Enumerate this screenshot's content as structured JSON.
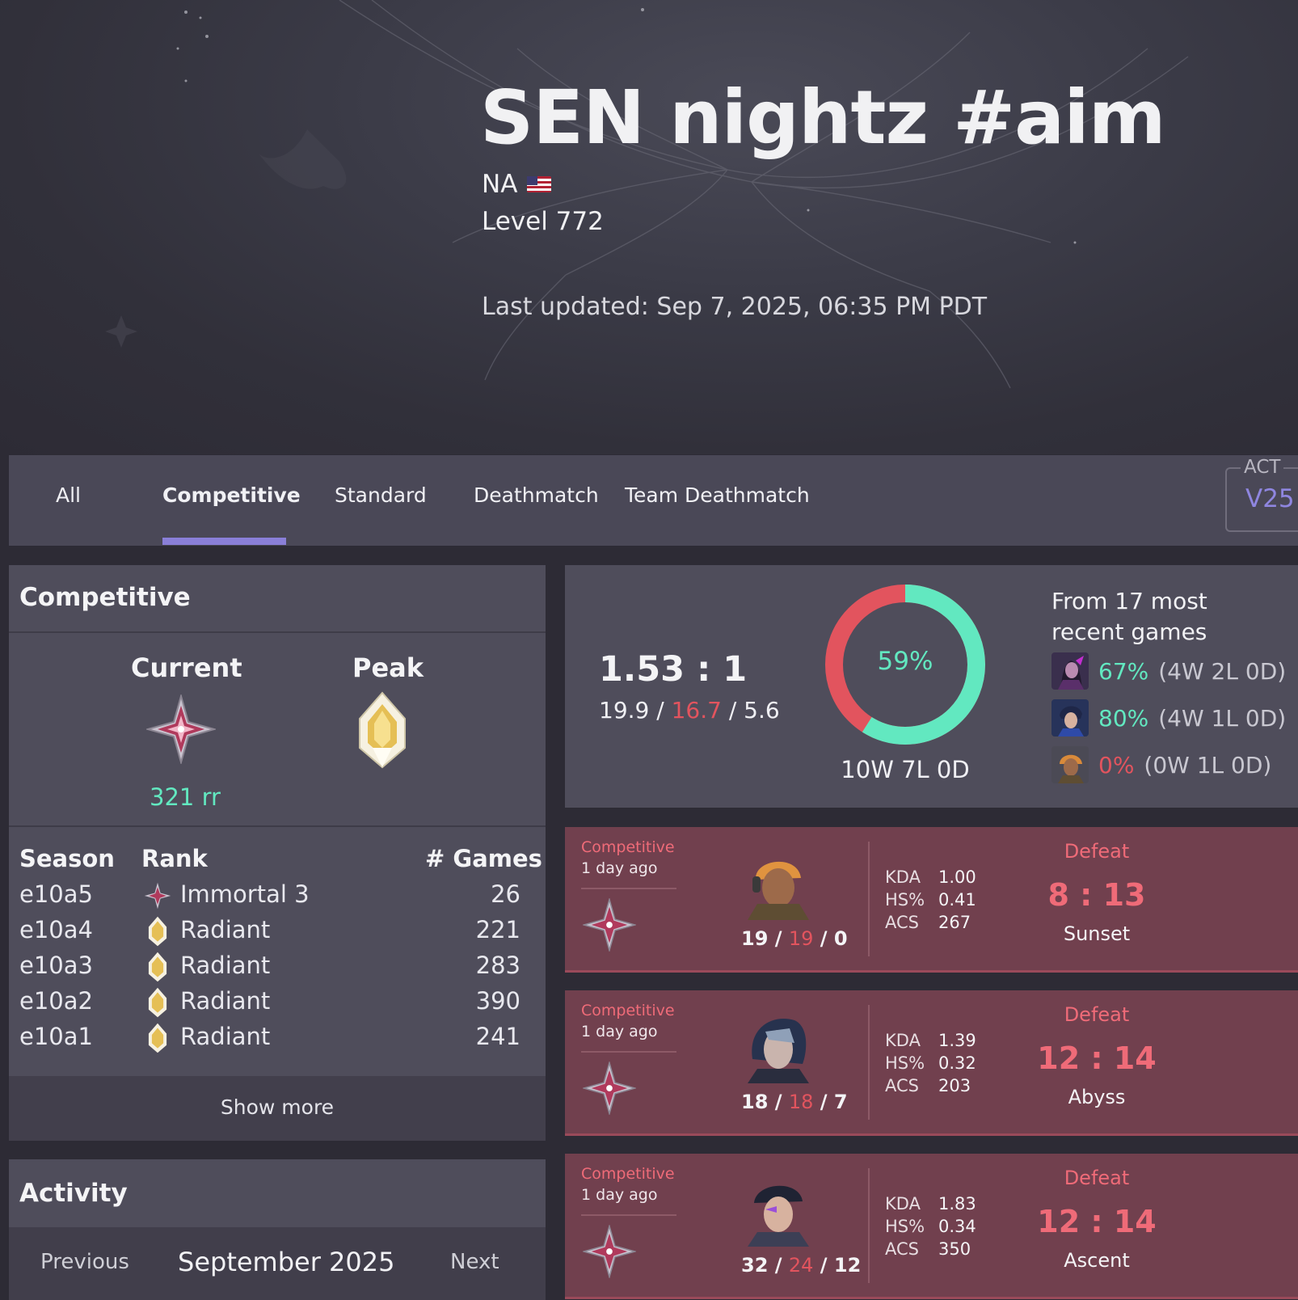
{
  "header": {
    "player_name": "SEN nightz #aim",
    "region": "NA",
    "level": "Level 772",
    "last_updated": "Last updated: Sep 7, 2025, 06:35 PM PDT"
  },
  "tabs": [
    {
      "label": "All",
      "active": false
    },
    {
      "label": "Competitive",
      "active": true
    },
    {
      "label": "Standard",
      "active": false
    },
    {
      "label": "Deathmatch",
      "active": false
    },
    {
      "label": "Team Deathmatch",
      "active": false
    }
  ],
  "act_selector": {
    "label": "ACT",
    "value": "V25"
  },
  "competitive": {
    "title": "Competitive",
    "current_label": "Current",
    "peak_label": "Peak",
    "current_rr": "321 rr",
    "table_headers": {
      "season": "Season",
      "rank": "Rank",
      "games": "# Games"
    },
    "seasons": [
      {
        "season": "e10a5",
        "rank": "Immortal 3",
        "icon": "immortal-icon",
        "games": "26"
      },
      {
        "season": "e10a4",
        "rank": "Radiant",
        "icon": "radiant-icon",
        "games": "221"
      },
      {
        "season": "e10a3",
        "rank": "Radiant",
        "icon": "radiant-icon",
        "games": "283"
      },
      {
        "season": "e10a2",
        "rank": "Radiant",
        "icon": "radiant-icon",
        "games": "390"
      },
      {
        "season": "e10a1",
        "rank": "Radiant",
        "icon": "radiant-icon",
        "games": "241"
      }
    ],
    "show_more": "Show more"
  },
  "activity": {
    "title": "Activity",
    "previous": "Previous",
    "month": "September 2025",
    "next": "Next"
  },
  "summary": {
    "kd_ratio": "1.53 : 1",
    "avg_kills": "19.9",
    "avg_deaths": "16.7",
    "avg_assists": "5.6",
    "win_percent_label": "59%",
    "win_fraction": 0.59,
    "record": "10W 7L 0D",
    "recent_title": "From 17 most recent games",
    "agents": [
      {
        "pct": "67%",
        "record": "(4W 2L 0D)",
        "color": "#62e8c0"
      },
      {
        "pct": "80%",
        "record": "(4W 1L 0D)",
        "color": "#62e8c0"
      },
      {
        "pct": "0%",
        "record": "(0W 1L 0D)",
        "color": "#e2545e"
      }
    ]
  },
  "matches": [
    {
      "mode": "Competitive",
      "ago": "1 day ago",
      "k": "19",
      "d": "19",
      "a": "0",
      "kda_label": "KDA",
      "kda": "1.00",
      "hs_label": "HS%",
      "hs": "0.41",
      "acs_label": "ACS",
      "acs": "267",
      "result": "Defeat",
      "score": "8 : 13",
      "map": "Sunset"
    },
    {
      "mode": "Competitive",
      "ago": "1 day ago",
      "k": "18",
      "d": "18",
      "a": "7",
      "kda_label": "KDA",
      "kda": "1.39",
      "hs_label": "HS%",
      "hs": "0.32",
      "acs_label": "ACS",
      "acs": "203",
      "result": "Defeat",
      "score": "12 : 14",
      "map": "Abyss"
    },
    {
      "mode": "Competitive",
      "ago": "1 day ago",
      "k": "32",
      "d": "24",
      "a": "12",
      "kda_label": "KDA",
      "kda": "1.83",
      "hs_label": "HS%",
      "hs": "0.34",
      "acs_label": "ACS",
      "acs": "350",
      "result": "Defeat",
      "score": "12 : 14",
      "map": "Ascent"
    }
  ],
  "colors": {
    "accent": "#8a7fd8",
    "win": "#62e8c0",
    "loss": "#e2545e",
    "defeat_card": "#71404e"
  }
}
